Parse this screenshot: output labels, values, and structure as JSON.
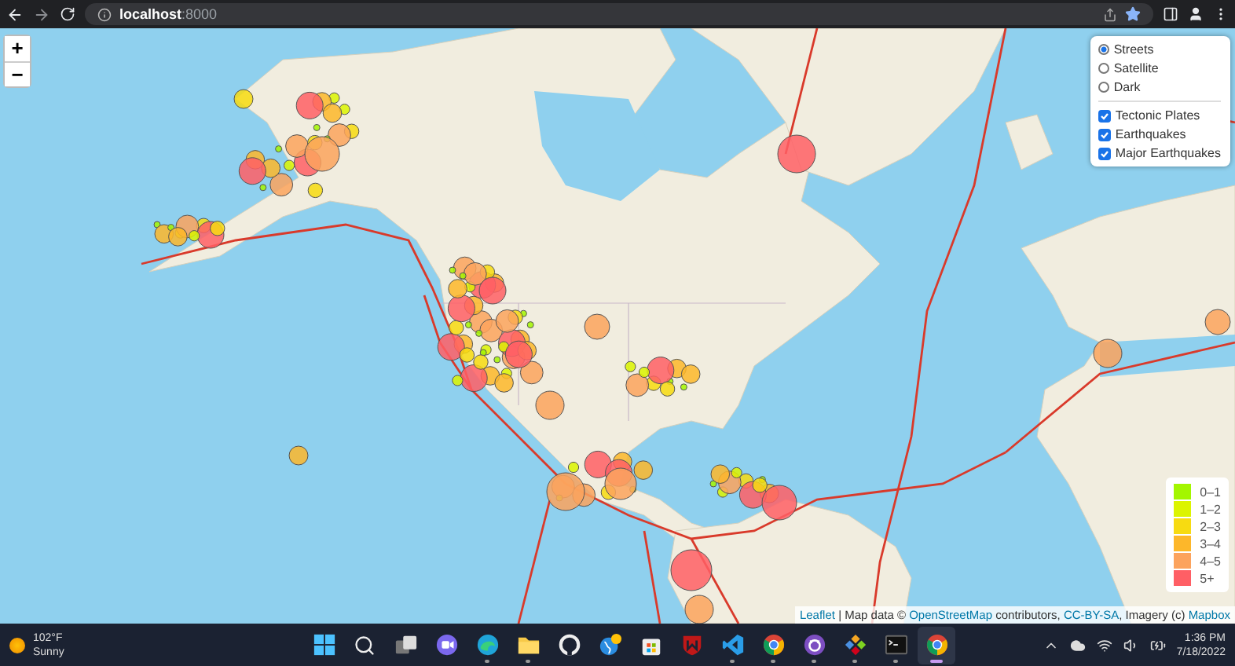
{
  "browser": {
    "url": "**localhost**:8000",
    "bookmarked": true
  },
  "map": {
    "zoom_controls": [
      "+",
      "−"
    ],
    "layer_control": {
      "base_layers": [
        {
          "label": "Streets",
          "selected": true
        },
        {
          "label": "Satellite",
          "selected": false
        },
        {
          "label": "Dark",
          "selected": false
        }
      ],
      "overlays": [
        {
          "label": "Tectonic Plates",
          "checked": true
        },
        {
          "label": "Earthquakes",
          "checked": true
        },
        {
          "label": "Major Earthquakes",
          "checked": true
        }
      ]
    },
    "legend": [
      {
        "label": "0–1",
        "color": "#a3f600"
      },
      {
        "label": "1–2",
        "color": "#dcf400"
      },
      {
        "label": "2–3",
        "color": "#f7db11"
      },
      {
        "label": "3–4",
        "color": "#fdb72a"
      },
      {
        "label": "4–5",
        "color": "#fca35d"
      },
      {
        "label": "5+",
        "color": "#ff5f65"
      }
    ],
    "attribution": [
      {
        "kind": "link",
        "text": "Leaflet"
      },
      {
        "kind": "text",
        "text": " | Map data © "
      },
      {
        "kind": "link",
        "text": "OpenStreetMap"
      },
      {
        "kind": "text",
        "text": " contributors, "
      },
      {
        "kind": "link",
        "text": "CC-BY-SA"
      },
      {
        "kind": "text",
        "text": ", Imagery (c) "
      },
      {
        "kind": "link",
        "text": "Mapbox"
      }
    ]
  },
  "taskbar": {
    "weather": {
      "temperature": "102°F",
      "condition": "Sunny"
    },
    "apps": [
      {
        "kind": "start",
        "running": false,
        "active": false
      },
      {
        "kind": "search",
        "running": false,
        "active": false
      },
      {
        "kind": "taskview",
        "running": false,
        "active": false
      },
      {
        "kind": "chat",
        "running": false,
        "active": false
      },
      {
        "kind": "edge",
        "running": true,
        "active": false
      },
      {
        "kind": "folder",
        "running": true,
        "active": false
      },
      {
        "kind": "ring",
        "running": false,
        "active": false
      },
      {
        "kind": "globe",
        "running": false,
        "active": false
      },
      {
        "kind": "store",
        "running": false,
        "active": false
      },
      {
        "kind": "shield",
        "running": false,
        "active": false
      },
      {
        "kind": "code",
        "running": true,
        "active": false
      },
      {
        "kind": "chrome",
        "running": true,
        "active": false
      },
      {
        "kind": "cat",
        "running": true,
        "active": false
      },
      {
        "kind": "diamond",
        "running": true,
        "active": false
      },
      {
        "kind": "terminal",
        "running": true,
        "active": false
      },
      {
        "kind": "chrome",
        "running": false,
        "active": true
      }
    ],
    "time": "1:36 PM",
    "date": "7/18/2022"
  }
}
